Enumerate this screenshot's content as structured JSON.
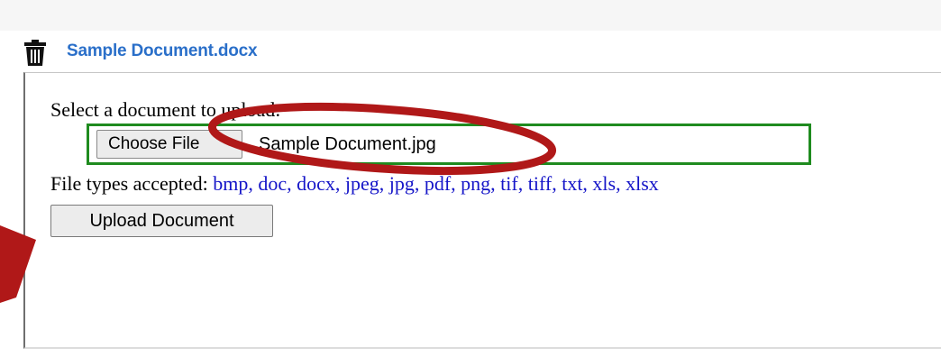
{
  "header": {
    "document_link": "Sample Document.docx",
    "delete_icon": "trash-icon"
  },
  "upload_form": {
    "select_label": "Select a document to upload:",
    "choose_file_label": "Choose File",
    "selected_file": "Sample Document.jpg",
    "file_types_label": "File types accepted:",
    "file_types": "bmp, doc, docx, jpeg, jpg, pdf, png, tif, tiff, txt, xls, xlsx",
    "upload_button": "Upload Document"
  },
  "annotations": {
    "highlight_color": "#b01818",
    "shapes": [
      "ellipse",
      "arrow"
    ]
  },
  "colors": {
    "link": "#2a6fc9",
    "file_types_text": "#1515c8",
    "file_input_border": "#1f8b1f"
  }
}
